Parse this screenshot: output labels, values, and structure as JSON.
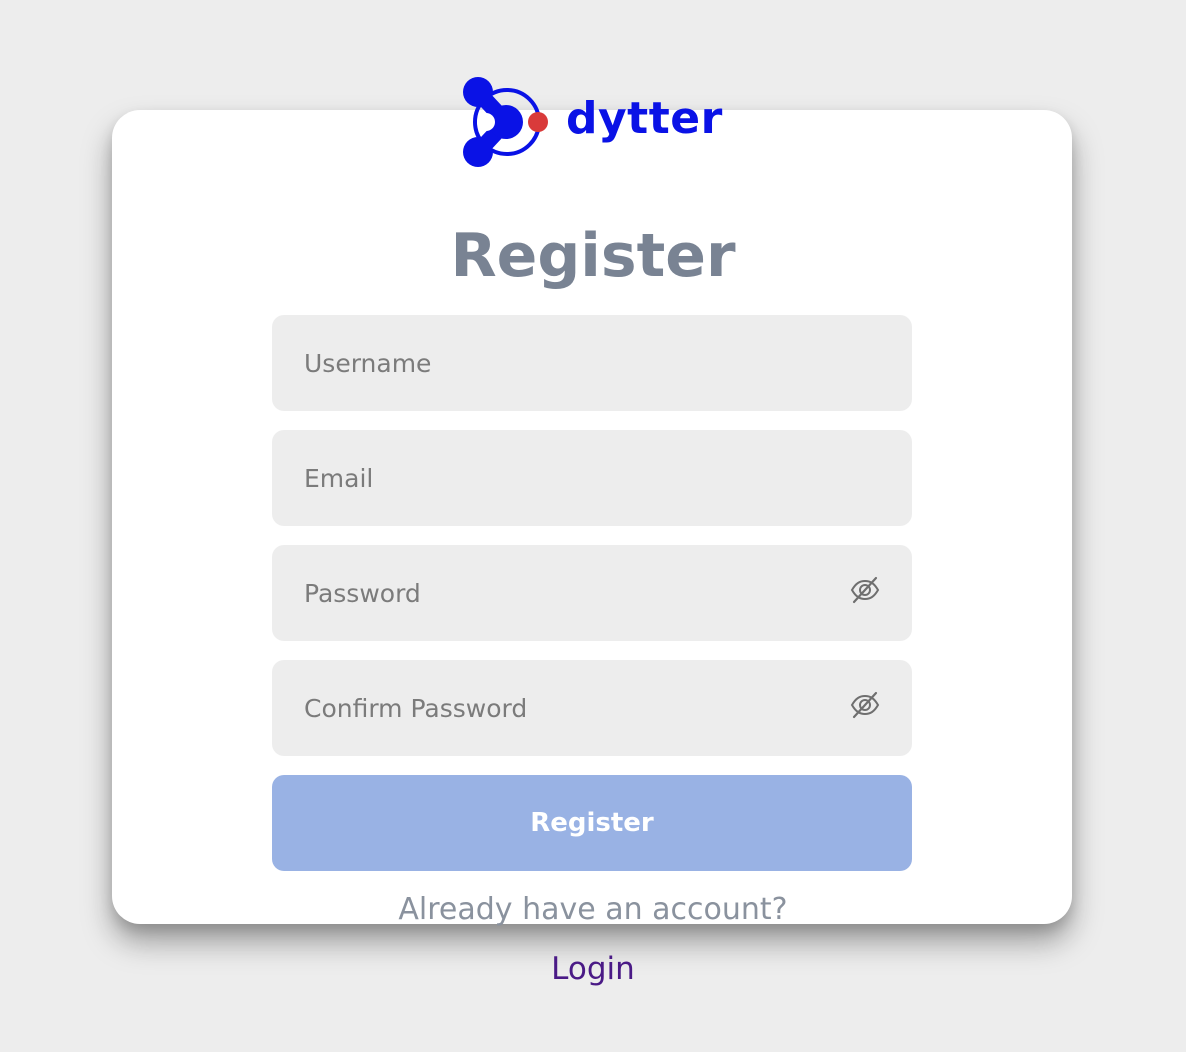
{
  "brand": {
    "name": "dytter",
    "color": "#0a12e6",
    "accent": "#d93a3a"
  },
  "page": {
    "title": "Register"
  },
  "form": {
    "username_placeholder": "Username",
    "email_placeholder": "Email",
    "password_placeholder": "Password",
    "confirm_password_placeholder": "Confirm Password",
    "password_toggle_icon": "eye-slash-icon",
    "submit_label": "Register",
    "submit_color": "#99b2e4"
  },
  "footer": {
    "prompt": "Already have an account?",
    "login_label": "Login",
    "login_color": "#4a1a86"
  }
}
